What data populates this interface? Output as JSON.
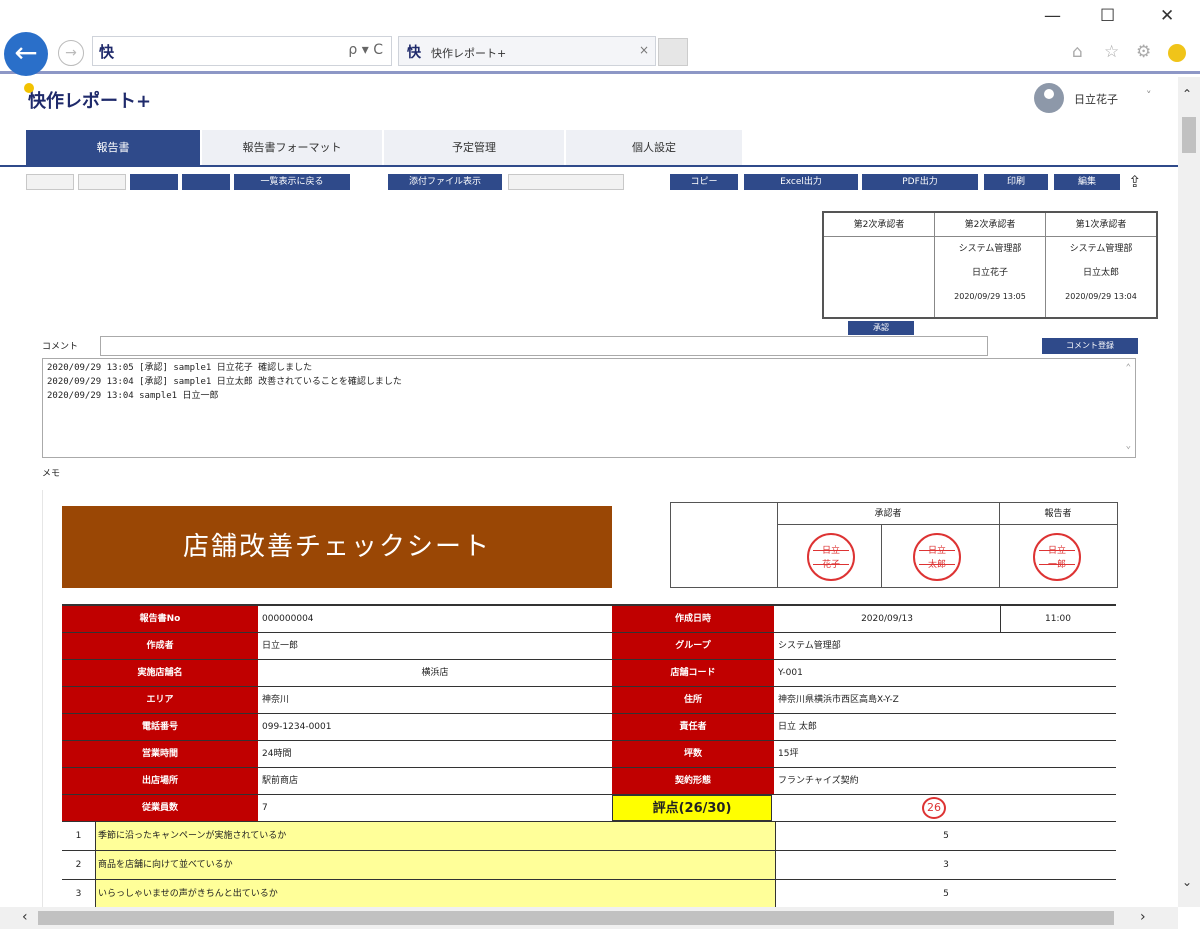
{
  "window": {
    "minimize": "—",
    "maximize": "☐",
    "close": "✕"
  },
  "browser": {
    "back": "←",
    "forward": "→",
    "fav": "快",
    "address_tools": "ρ ▾ C",
    "tab_title": "快作レポート+",
    "tab_close": "×",
    "right_tools": [
      "⌂",
      "☆",
      "⚙"
    ]
  },
  "app": {
    "logo": "快作レポート+",
    "user_name": "日立花子",
    "user_chevron": "˅"
  },
  "tabs": [
    "報告書",
    "報告書フォーマット",
    "予定管理",
    "個人設定"
  ],
  "toolbar": {
    "buttons": [
      "一覧表示に戻る",
      "添付ファイル表示",
      "コピー",
      "Excel出力",
      "PDF出力",
      "印刷",
      "編集"
    ],
    "share_icon": "⇪"
  },
  "approvals": [
    {
      "header": "第2次承認者",
      "dept": "",
      "name": "",
      "time": ""
    },
    {
      "header": "第2次承認者",
      "dept": "システム管理部",
      "name": "日立花子",
      "time": "2020/09/29 13:05"
    },
    {
      "header": "第1次承認者",
      "dept": "システム管理部",
      "name": "日立太郎",
      "time": "2020/09/29 13:04"
    }
  ],
  "confirm_label": "承認",
  "comments": {
    "label": "コメント",
    "button": "コメント登録",
    "log": [
      "2020/09/29 13:05 [承認] sample1 日立花子 確認しました",
      "2020/09/29 13:04 [承認] sample1 日立太郎 改善されていることを確認しました",
      "2020/09/29 13:04 sample1 日立一郎"
    ]
  },
  "memo_label": "メモ",
  "report": {
    "title": "店舗改善チェックシート",
    "stamp_header_approver": "承認者",
    "stamp_header_reporter": "報告者",
    "seals": [
      {
        "top": "日立",
        "mid": "花子"
      },
      {
        "top": "日立",
        "mid": "太郎"
      },
      {
        "top": "日立",
        "mid": "一郎"
      }
    ],
    "fields": [
      {
        "l1": "報告書No",
        "v1": "000000004",
        "l2": "作成日時",
        "v2": "2020/09/13",
        "v3": "11:00"
      },
      {
        "l1": "作成者",
        "v1": "日立一郎",
        "l2": "グループ",
        "v2": "システム管理部"
      },
      {
        "l1": "実施店舗名",
        "v1": "横浜店",
        "l2": "店舗コード",
        "v2": "Y-001"
      },
      {
        "l1": "エリア",
        "v1": "神奈川",
        "l2": "住所",
        "v2": "神奈川県横浜市西区高島X-Y-Z"
      },
      {
        "l1": "電話番号",
        "v1": "099-1234-0001",
        "l2": "責任者",
        "v2": "日立 太郎"
      },
      {
        "l1": "営業時間",
        "v1": "24時間",
        "l2": "坪数",
        "v2": "15坪"
      },
      {
        "l1": "出店場所",
        "v1": "駅前商店",
        "l2": "契約形態",
        "v2": "フランチャイズ契約"
      },
      {
        "l1": "従業員数",
        "v1": "7",
        "score_label": "評点(26/30)",
        "score_value": "26"
      }
    ],
    "questions": [
      {
        "no": "1",
        "text": "季節に沿ったキャンペーンが実施されているか",
        "score": "5"
      },
      {
        "no": "2",
        "text": "商品を店舗に向けて並べているか",
        "score": "3"
      },
      {
        "no": "3",
        "text": "いらっしゃいませの声がきちんと出ているか",
        "score": "5"
      }
    ]
  },
  "scroll": {
    "up": "⌃",
    "down": "⌄",
    "left": "‹",
    "right": "›"
  }
}
